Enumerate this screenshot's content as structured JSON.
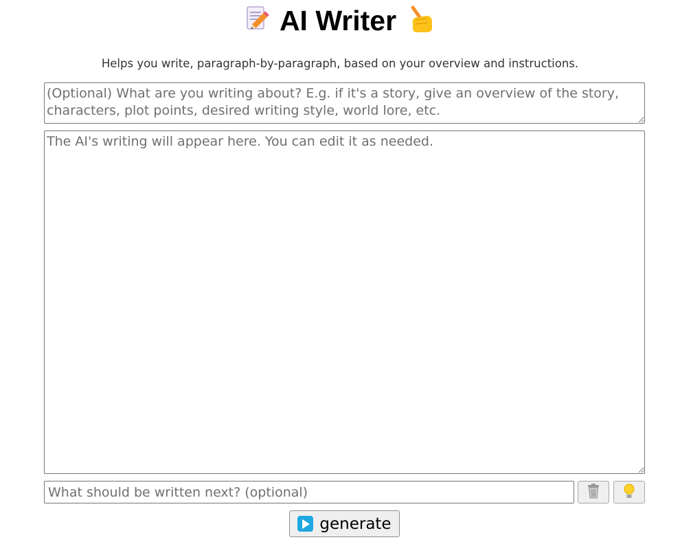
{
  "header": {
    "title": "AI Writer",
    "left_icon": "memo-pencil-icon",
    "right_icon": "writing-hand-icon",
    "subtitle": "Helps you write, paragraph-by-paragraph, based on your overview and instructions."
  },
  "overview": {
    "placeholder": "(Optional) What are you writing about? E.g. if it's a story, give an overview of the story, characters, plot points, desired writing style, world lore, etc.",
    "value": ""
  },
  "output": {
    "placeholder": "The AI's writing will appear here. You can edit it as needed.",
    "value": ""
  },
  "next_instruction": {
    "placeholder": "What should be written next? (optional)",
    "value": ""
  },
  "toolbar": {
    "clear_icon": "trash-can-icon",
    "idea_icon": "light-bulb-icon",
    "generate_label": "generate",
    "generate_icon": "play-button-icon"
  },
  "colors": {
    "accent_play": "#1ea7e1",
    "button_bg": "#efefef",
    "border": "#767676"
  }
}
